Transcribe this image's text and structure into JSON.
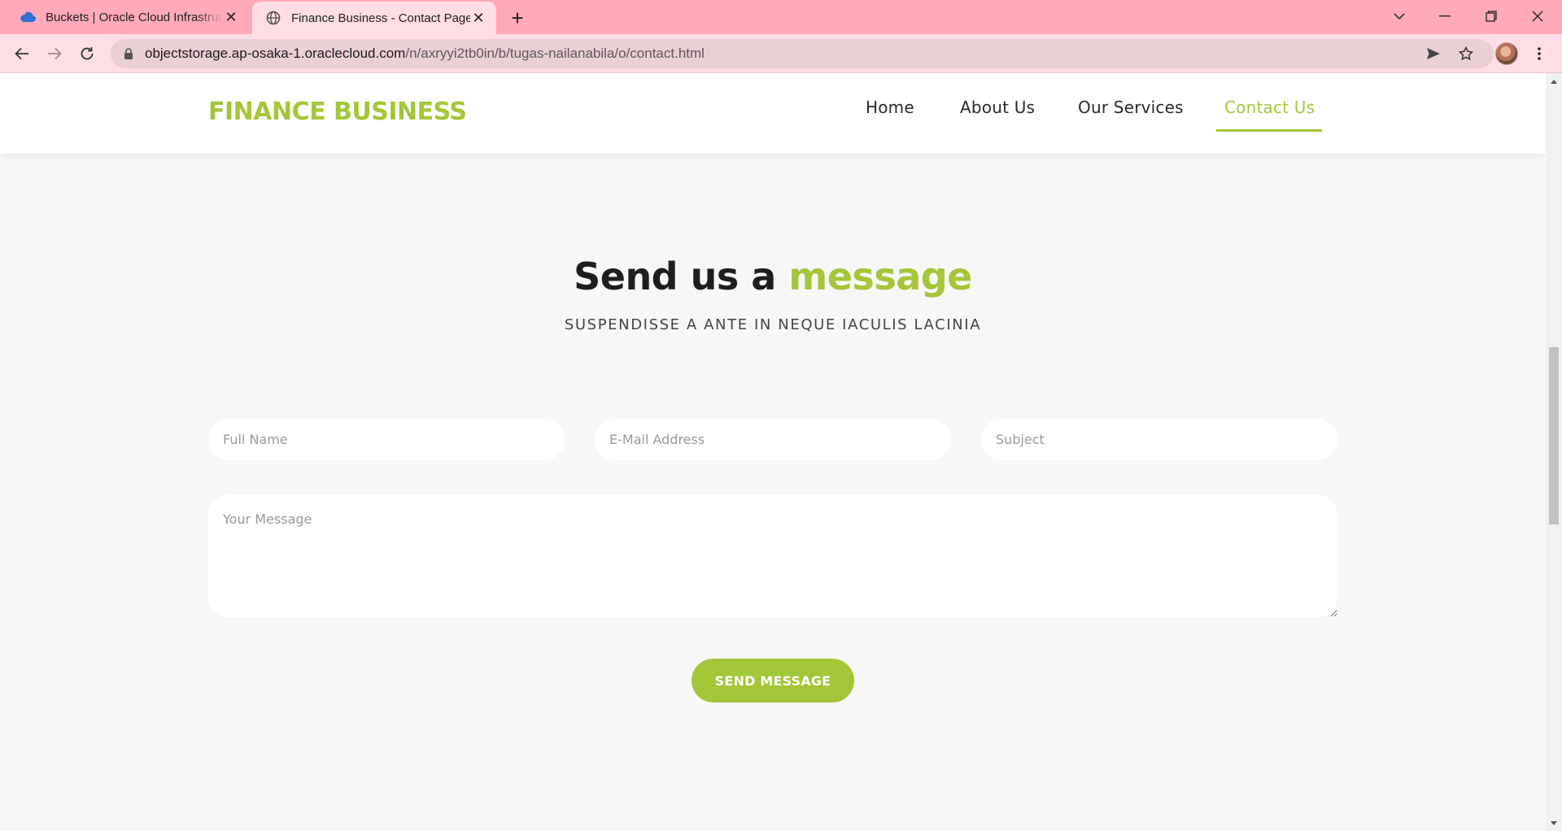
{
  "browser": {
    "tabs": [
      {
        "title": "Buckets | Oracle Cloud Infrastructure",
        "favicon": "cloud-icon",
        "active": false
      },
      {
        "title": "Finance Business - Contact Page",
        "favicon": "globe-icon",
        "active": true
      }
    ],
    "close_glyph": "✕",
    "new_tab_glyph": "+",
    "url_host": "objectstorage.ap-osaka-1.oraclecloud.com",
    "url_path": "/n/axryyi2tb0in/b/tugas-nailanabila/o/contact.html",
    "tabstrip_color": "#ffa9b9",
    "toolbar_color": "#ffdde4"
  },
  "site": {
    "logo": "FINANCE BUSINESS",
    "nav": [
      {
        "label": "Home",
        "active": false
      },
      {
        "label": "About Us",
        "active": false
      },
      {
        "label": "Our Services",
        "active": false
      },
      {
        "label": "Contact Us",
        "active": true
      }
    ],
    "accent_color": "#a4c639"
  },
  "contact": {
    "title_main": "Send us a ",
    "title_accent": "message",
    "subtitle": "SUSPENDISSE A ANTE IN NEQUE IACULIS LACINIA",
    "placeholders": {
      "full_name": "Full Name",
      "email": "E-Mail Address",
      "subject": "Subject",
      "message": "Your Message"
    },
    "submit_label": "SEND MESSAGE"
  }
}
